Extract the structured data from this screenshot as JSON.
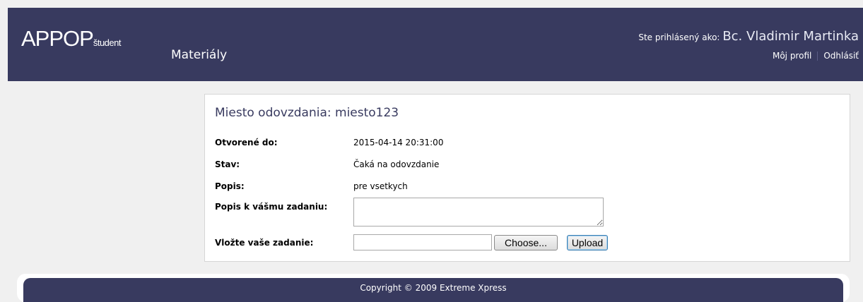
{
  "header": {
    "logo_main": "APPOP",
    "logo_sub": "študent",
    "nav_materialy": "Materiály",
    "user_prefix": "Ste prihlásený ako:",
    "user_name": "Bc. Vladimir Martinka",
    "profile_link": "Môj profil",
    "logout_link": "Odhlásiť"
  },
  "panel": {
    "title": "Miesto odovzdania: miesto123",
    "rows": [
      {
        "label": "Otvorené do:",
        "value": "2015-04-14 20:31:00"
      },
      {
        "label": "Stav:",
        "value": "Čaká na odovzdanie"
      },
      {
        "label": "Popis:",
        "value": "pre vsetkych"
      },
      {
        "label": "Popis k vášmu zadaniu:",
        "value": ""
      },
      {
        "label": "Vložte vaše zadanie:",
        "value": ""
      }
    ],
    "choose_button": "Choose...",
    "upload_button": "Upload"
  },
  "footer": {
    "copyright": "Copyright © 2009 Extreme Xpress"
  }
}
